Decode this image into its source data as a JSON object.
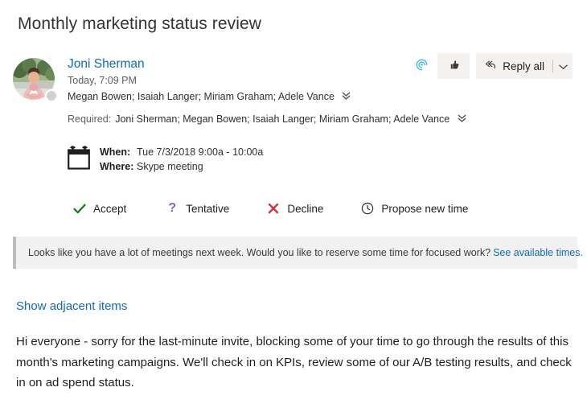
{
  "subject": "Monthly marketing status review",
  "header": {
    "sender_name": "Joni Sherman",
    "sent_time": "Today, 7:09 PM",
    "recipients": "Megan Bowen; Isaiah Langer; Miriam Graham; Adele Vance",
    "required_label": "Required:",
    "required_recipients": "Joni Sherman; Megan Bowen; Isaiah Langer; Miriam Graham; Adele Vance",
    "expand_icon": "double-chevron-down-icon",
    "actions": {
      "insights_icon": "cortana-insights-icon",
      "like_icon": "thumbs-up-icon",
      "reply_all_icon": "reply-all-icon",
      "reply_all_label": "Reply all",
      "reply_all_caret_icon": "chevron-down-icon"
    }
  },
  "meeting": {
    "calendar_icon": "calendar-icon",
    "when_label": "When:",
    "when_value": "Tue 7/3/2018 9:00a - 10:00a",
    "where_label": "Where:",
    "where_value": "Skype meeting"
  },
  "rsvp": {
    "accept": {
      "label": "Accept",
      "icon": "checkmark-icon",
      "color": "#107c10"
    },
    "tentative": {
      "label": "Tentative",
      "icon": "question-mark-icon",
      "color": "#8764b8"
    },
    "decline": {
      "label": "Decline",
      "icon": "cross-icon",
      "color": "#d13438"
    },
    "propose": {
      "label": "Propose new time",
      "icon": "clock-icon",
      "color": "#323130"
    }
  },
  "banner": {
    "message": "Looks like you have a lot of meetings next week. Would you like to reserve some time for focused work?",
    "link_text": "See available times.",
    "accent_color": "#bdbdbd",
    "background_color": "#f1f1f1"
  },
  "adjacent_items_link": "Show adjacent items",
  "body": "Hi everyone - sorry for the last-minute invite, blocking some of your time to go through the results of this month's marketing campaigns. We'll check in on KPIs, review some of our A/B testing results, and check in on ad spend status."
}
